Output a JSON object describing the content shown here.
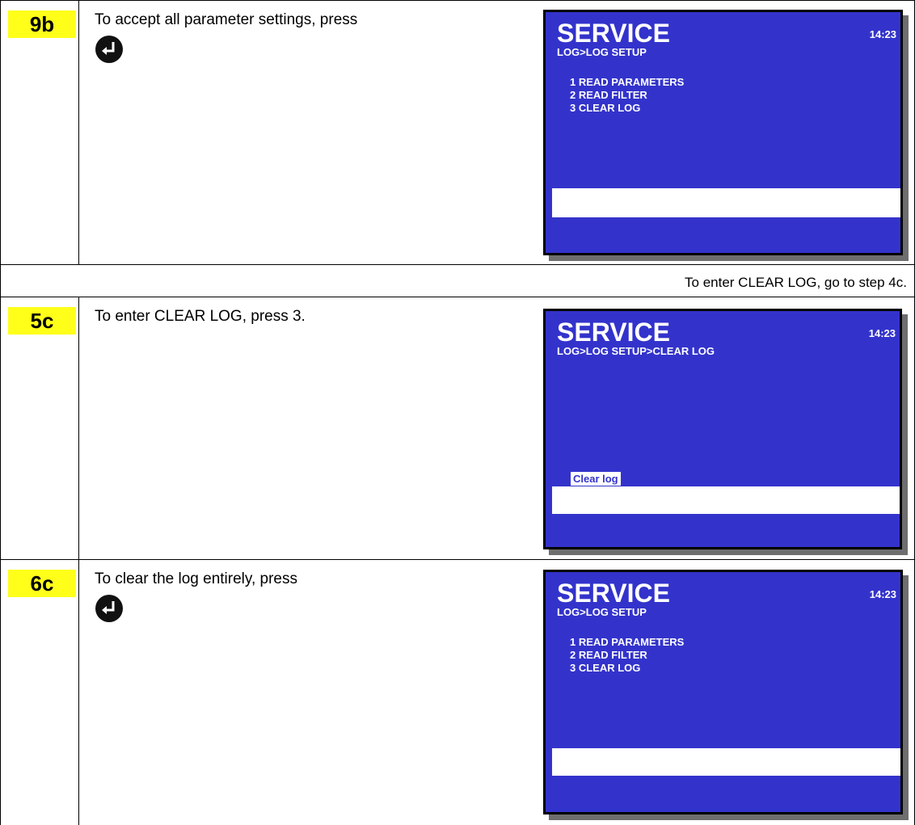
{
  "rows": [
    {
      "step": "9b",
      "instruction": "To accept all parameter settings, press",
      "icon": "enter-key-icon",
      "screen": {
        "title": "SERVICE",
        "time": "14:23",
        "path": "LOG>LOG SETUP",
        "menu": [
          "1 READ PARAMETERS",
          "2 READ FILTER",
          "3 CLEAR LOG"
        ]
      }
    },
    {
      "note": "To enter CLEAR LOG, go to step 4c."
    },
    {
      "step": "5c",
      "instruction": "To enter CLEAR LOG, press 3.",
      "screen": {
        "title": "SERVICE",
        "time": "14:23",
        "path": "LOG>LOG SETUP>CLEAR LOG",
        "highlight": "Clear log"
      }
    },
    {
      "step": "6c",
      "instruction": "To clear the log entirely, press",
      "icon": "enter-key-icon",
      "screen": {
        "title": "SERVICE",
        "time": "14:23",
        "path": "LOG>LOG SETUP",
        "menu": [
          "1 READ PARAMETERS",
          "2 READ FILTER",
          "3 CLEAR LOG"
        ]
      }
    }
  ],
  "colors": {
    "badge": "#ffff1a",
    "screen_bg": "#3333cc",
    "screen_text": "#ffffff"
  }
}
